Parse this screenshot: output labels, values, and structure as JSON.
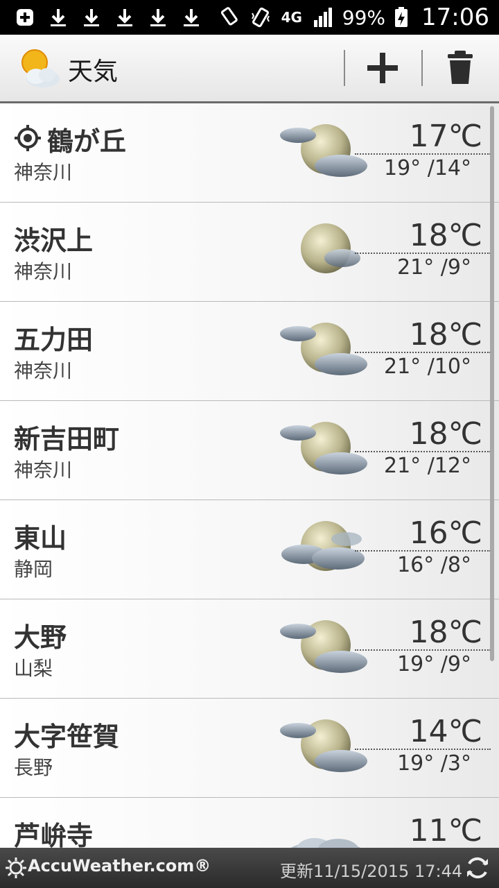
{
  "status_bar": {
    "battery": "99%",
    "time": "17:06",
    "network": "4G"
  },
  "app": {
    "title": "天気"
  },
  "locations": [
    {
      "city": "鶴が丘",
      "prefecture": "神奈川",
      "current_temp": "17℃",
      "hi_lo": "19° /14°",
      "current_location": true,
      "icon": "partly-cloudy-night-icon"
    },
    {
      "city": "渋沢上",
      "prefecture": "神奈川",
      "current_temp": "18℃",
      "hi_lo": "21° /9°",
      "current_location": false,
      "icon": "mostly-clear-night-icon"
    },
    {
      "city": "五力田",
      "prefecture": "神奈川",
      "current_temp": "18℃",
      "hi_lo": "21° /10°",
      "current_location": false,
      "icon": "partly-cloudy-night-icon"
    },
    {
      "city": "新吉田町",
      "prefecture": "神奈川",
      "current_temp": "18℃",
      "hi_lo": "21° /12°",
      "current_location": false,
      "icon": "partly-cloudy-night-icon"
    },
    {
      "city": "東山",
      "prefecture": "静岡",
      "current_temp": "16℃",
      "hi_lo": "16° /8°",
      "current_location": false,
      "icon": "mostly-cloudy-night-icon"
    },
    {
      "city": "大野",
      "prefecture": "山梨",
      "current_temp": "18℃",
      "hi_lo": "19° /9°",
      "current_location": false,
      "icon": "partly-cloudy-night-icon"
    },
    {
      "city": "大字笹賀",
      "prefecture": "長野",
      "current_temp": "14℃",
      "hi_lo": "19° /3°",
      "current_location": false,
      "icon": "partly-cloudy-night-icon"
    },
    {
      "city": "芦峅寺",
      "prefecture": "",
      "current_temp": "11℃",
      "hi_lo": "",
      "current_location": false,
      "icon": "cloudy-icon"
    }
  ],
  "footer": {
    "brand": "AccuWeather.com®",
    "updated": "更新11/15/2015 17:44"
  },
  "colors": {
    "status_bar_bg": "#000000",
    "footer_bg": "#333333",
    "divider": "#b9b9b9"
  }
}
